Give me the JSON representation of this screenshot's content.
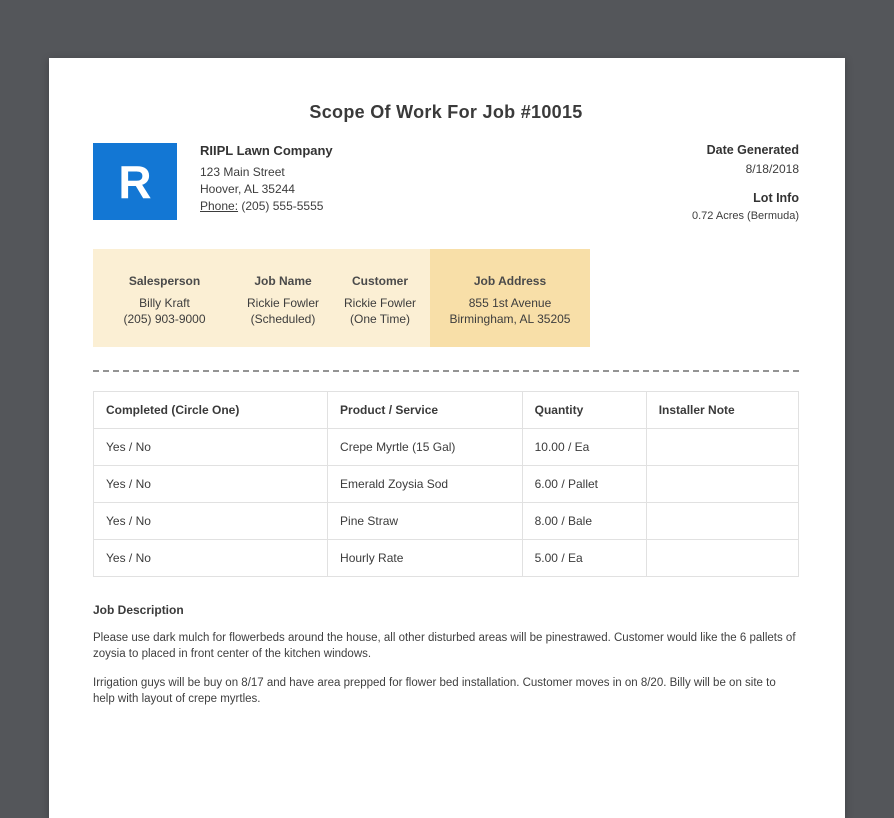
{
  "colors": {
    "backdrop": "#54565a",
    "logo_blue": "#1377d4",
    "band_light": "#fbefd4",
    "band_dark": "#f8dfa8"
  },
  "page": {
    "title": "Scope Of Work For Job #10015"
  },
  "company": {
    "logo_letter": "R",
    "name": "RIIPL Lawn Company",
    "address_line1": "123 Main Street",
    "address_line2": "Hoover, AL 35244",
    "phone_label": "Phone:",
    "phone_value": " (205) 555-5555"
  },
  "meta": {
    "date_generated_label": "Date Generated",
    "date_generated": "8/18/2018",
    "lot_info_label": "Lot Info",
    "lot_info": "0.72 Acres (Bermuda)"
  },
  "job_info": {
    "columns": [
      {
        "label": "Salesperson",
        "line1": "Billy Kraft",
        "line2": "(205) 903-9000"
      },
      {
        "label": "Job Name",
        "line1": "Rickie Fowler",
        "line2": "(Scheduled)"
      },
      {
        "label": "Customer",
        "line1": "Rickie Fowler",
        "line2": "(One Time)"
      },
      {
        "label": "Job Address",
        "line1": "855 1st Avenue",
        "line2": "Birmingham, AL 35205"
      }
    ]
  },
  "work_table": {
    "headers": [
      "Completed (Circle One)",
      "Product / Service",
      "Quantity",
      "Installer Note"
    ],
    "rows": [
      [
        "Yes / No",
        "Crepe Myrtle (15 Gal)",
        "10.00 / Ea",
        ""
      ],
      [
        "Yes / No",
        "Emerald Zoysia Sod",
        "6.00 / Pallet",
        ""
      ],
      [
        "Yes / No",
        "Pine Straw",
        "8.00 / Bale",
        ""
      ],
      [
        "Yes / No",
        "Hourly Rate",
        "5.00 / Ea",
        ""
      ]
    ]
  },
  "job_description": {
    "heading": "Job Description",
    "paragraphs": [
      "Please use dark mulch for flowerbeds around the house, all other disturbed areas will be pinestrawed. Customer would like the 6 pallets of zoysia to placed in front center of the kitchen windows.",
      "Irrigation guys will be buy on 8/17 and have area prepped for flower bed installation. Customer moves in on 8/20. Billy will be on site to help with layout of crepe myrtles."
    ]
  }
}
